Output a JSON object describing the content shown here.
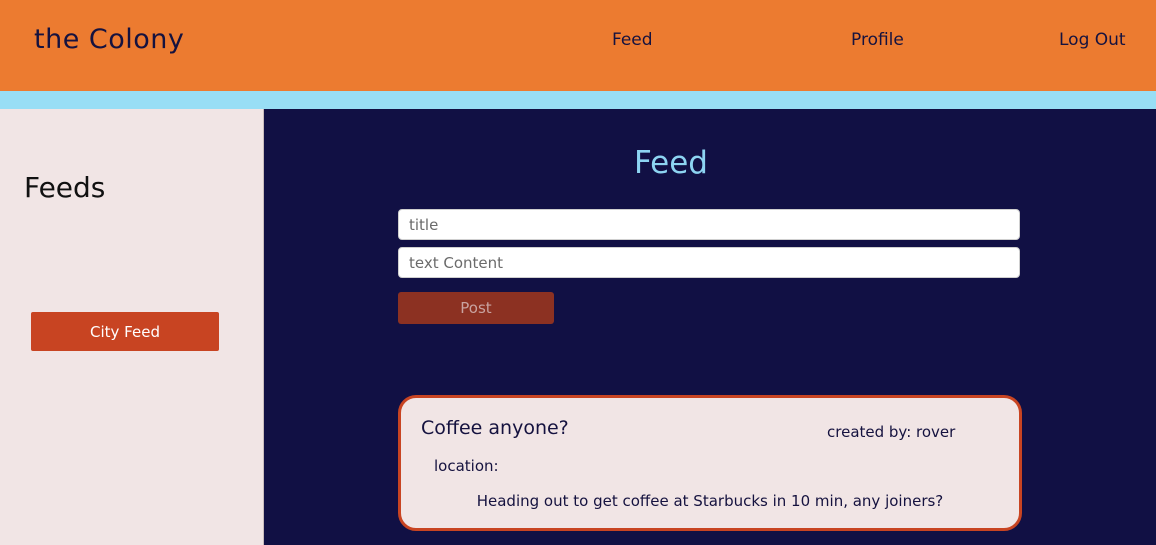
{
  "navbar": {
    "brand": "the Colony",
    "links": [
      {
        "label": "Feed"
      },
      {
        "label": "Profile"
      },
      {
        "label": "Log Out"
      }
    ]
  },
  "sidebar": {
    "title": "Feeds",
    "city_feed_label": "City Feed"
  },
  "main": {
    "title": "Feed",
    "form": {
      "title_placeholder": "title",
      "content_placeholder": "text Content",
      "post_label": "Post"
    },
    "posts": [
      {
        "title": "Coffee anyone?",
        "author_text": "created by: rover",
        "location_label": "location:",
        "body": "Heading out to get coffee at Starbucks in 10 min, any joiners?"
      }
    ]
  },
  "colors": {
    "navbar": "#ec7b30",
    "stripe": "#98def5",
    "sidebar": "#f1e5e5",
    "main": "#111044",
    "accent": "#c84422",
    "title": "#8dd4f2"
  }
}
